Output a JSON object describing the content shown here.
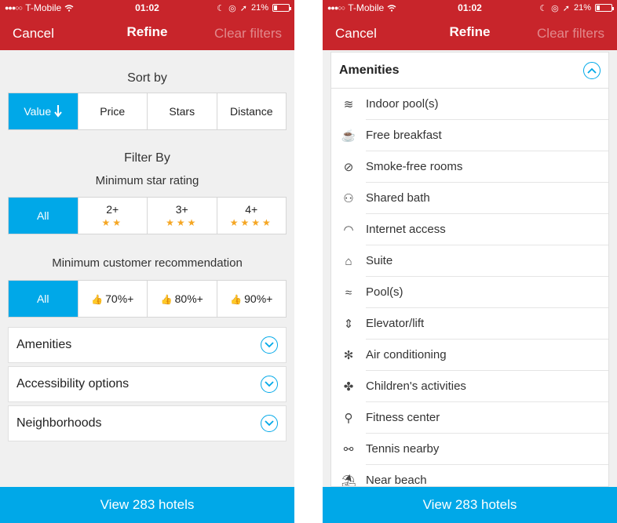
{
  "colors": {
    "brand_red": "#c8252b",
    "accent_blue": "#00a8e8",
    "star_gold": "#f5a623"
  },
  "status_bar": {
    "carrier": "T-Mobile",
    "time": "01:02",
    "battery": "21%",
    "battery_level": 0.21
  },
  "nav": {
    "cancel": "Cancel",
    "title": "Refine",
    "clear": "Clear filters"
  },
  "sort": {
    "title": "Sort by",
    "options": [
      {
        "label": "Value",
        "icon": "arrow-down-icon",
        "active": true
      },
      {
        "label": "Price"
      },
      {
        "label": "Stars"
      },
      {
        "label": "Distance"
      }
    ]
  },
  "filter": {
    "title": "Filter By",
    "star_title": "Minimum star rating",
    "stars": [
      {
        "label": "All",
        "active": true
      },
      {
        "label": "2+",
        "stars": "★★"
      },
      {
        "label": "3+",
        "stars": "★★★"
      },
      {
        "label": "4+",
        "stars": "★★★★"
      }
    ],
    "rec_title": "Minimum customer recommendation",
    "recommendation": [
      {
        "label": "All",
        "active": true
      },
      {
        "label": "70%+",
        "icon": "thumbs-up-icon"
      },
      {
        "label": "80%+",
        "icon": "thumbs-up-icon"
      },
      {
        "label": "90%+",
        "icon": "thumbs-up-icon"
      }
    ]
  },
  "accordions": [
    {
      "label": "Amenities",
      "icon": "chevron-down-icon"
    },
    {
      "label": "Accessibility options",
      "icon": "chevron-down-icon"
    },
    {
      "label": "Neighborhoods",
      "icon": "chevron-down-icon"
    }
  ],
  "footer": {
    "view_label": "View 283 hotels"
  },
  "amenities": {
    "header": "Amenities",
    "header_icon": "chevron-up-icon",
    "items": [
      {
        "label": "Indoor pool(s)",
        "icon": "indoor-pool-icon",
        "glyph": "≋"
      },
      {
        "label": "Free breakfast",
        "icon": "breakfast-cup-icon",
        "glyph": "☕"
      },
      {
        "label": "Smoke-free rooms",
        "icon": "no-smoking-icon",
        "glyph": "⊘"
      },
      {
        "label": "Shared bath",
        "icon": "shared-bath-icon",
        "glyph": "⚇"
      },
      {
        "label": "Internet access",
        "icon": "wifi-icon",
        "glyph": "◠"
      },
      {
        "label": "Suite",
        "icon": "suite-icon",
        "glyph": "⌂"
      },
      {
        "label": "Pool(s)",
        "icon": "pool-icon",
        "glyph": "≈"
      },
      {
        "label": "Elevator/lift",
        "icon": "elevator-icon",
        "glyph": "⇕"
      },
      {
        "label": "Air conditioning",
        "icon": "snowflake-icon",
        "glyph": "✻"
      },
      {
        "label": "Children's activities",
        "icon": "puzzle-icon",
        "glyph": "✤"
      },
      {
        "label": "Fitness center",
        "icon": "fitness-icon",
        "glyph": "⚲"
      },
      {
        "label": "Tennis nearby",
        "icon": "tennis-icon",
        "glyph": "⚯"
      },
      {
        "label": "Near beach",
        "icon": "beach-icon",
        "glyph": "⛱"
      }
    ]
  }
}
